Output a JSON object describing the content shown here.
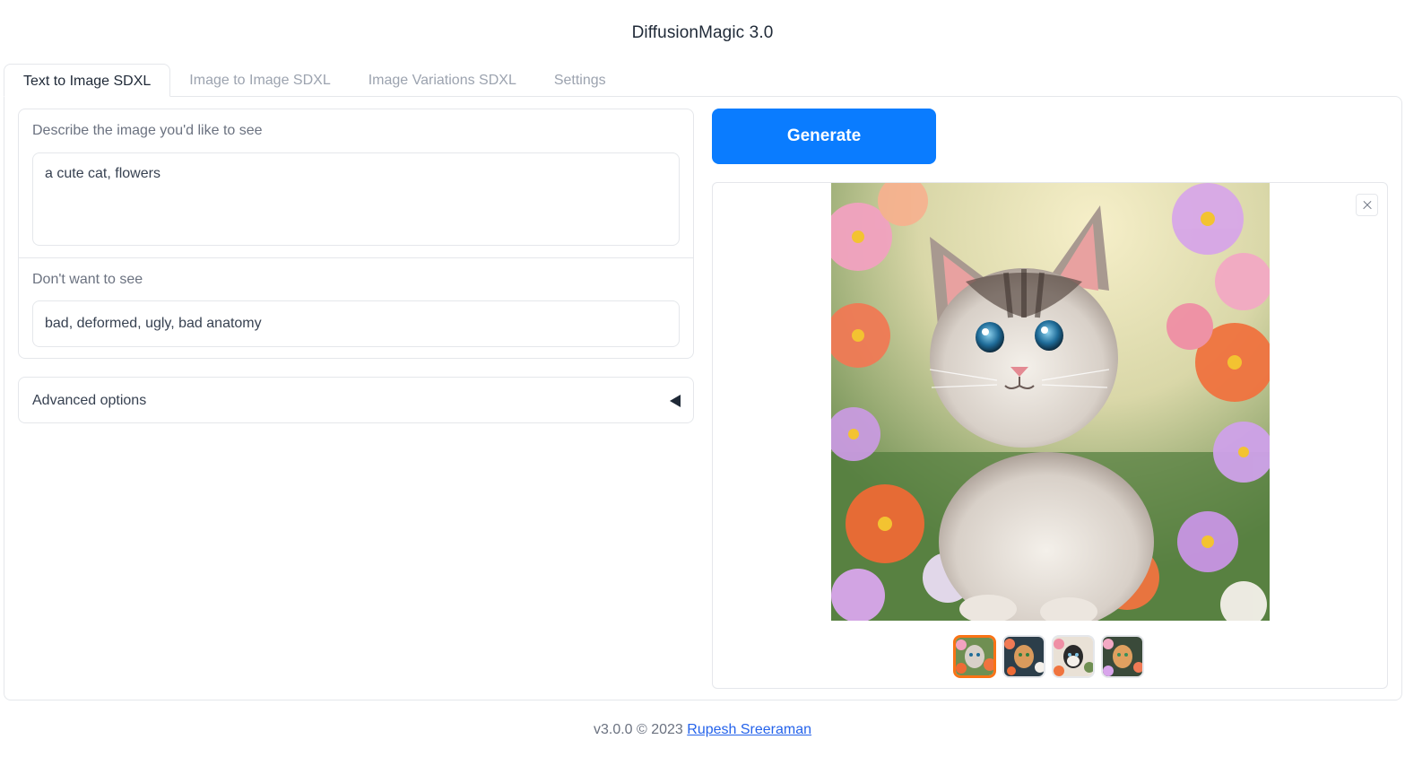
{
  "app": {
    "title": "DiffusionMagic 3.0"
  },
  "tabs": [
    {
      "label": "Text to Image SDXL",
      "active": true
    },
    {
      "label": "Image to Image SDXL",
      "active": false
    },
    {
      "label": "Image Variations SDXL",
      "active": false
    },
    {
      "label": "Settings",
      "active": false
    }
  ],
  "prompt": {
    "label": "Describe the image you'd like to see",
    "value": "a cute cat, flowers"
  },
  "negative_prompt": {
    "label": "Don't want to see",
    "value": "bad, deformed, ugly, bad anatomy"
  },
  "advanced": {
    "label": "Advanced options",
    "icon": "caret-left-icon"
  },
  "generate": {
    "label": "Generate",
    "color": "#0a7cff"
  },
  "gallery": {
    "thumbnail_count": 4,
    "selected_index": 0,
    "close_icon": "close-icon",
    "selected_color": "#f97316"
  },
  "footer": {
    "text": "v3.0.0 © 2023 ",
    "link_text": "Rupesh Sreeraman"
  }
}
